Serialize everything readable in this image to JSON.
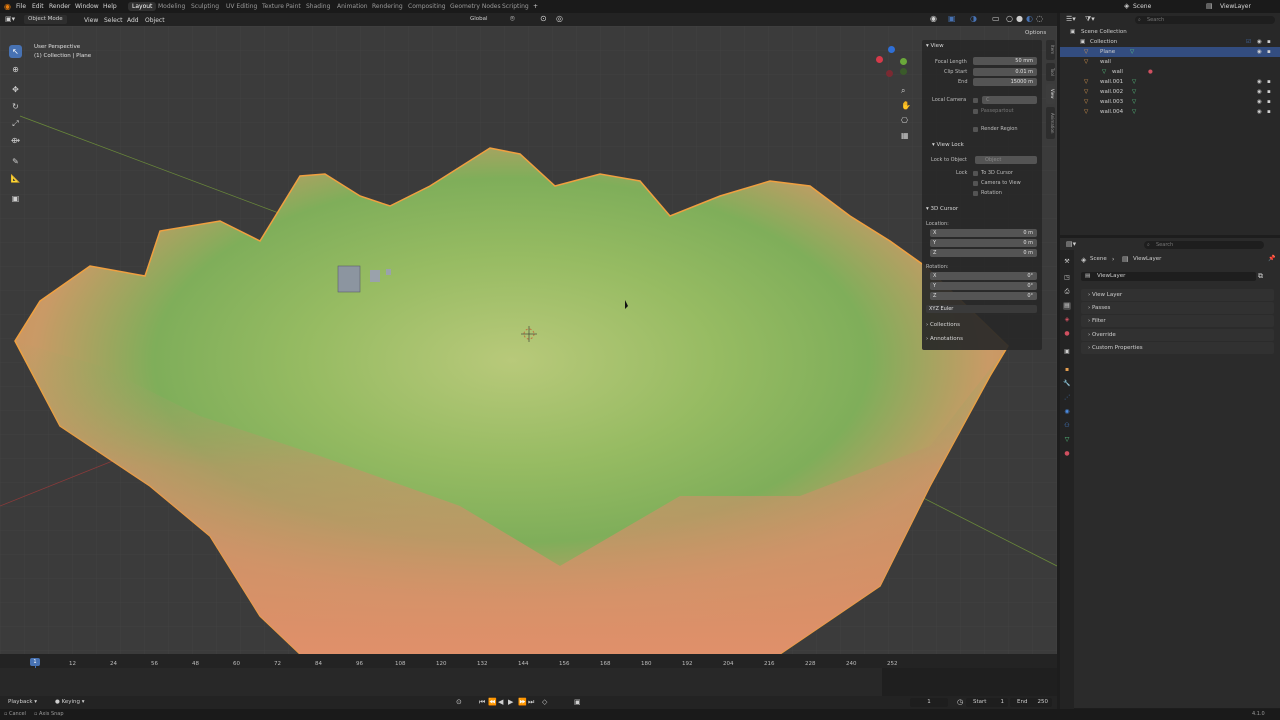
{
  "topbar": {
    "menus": [
      "File",
      "Edit",
      "Render",
      "Window",
      "Help"
    ],
    "workspaces": [
      "Layout",
      "Modeling",
      "Sculpting",
      "UV Editing",
      "Texture Paint",
      "Shading",
      "Animation",
      "Rendering",
      "Compositing",
      "Geometry Nodes",
      "Scripting"
    ],
    "add_tab": "+",
    "scene": "Scene",
    "viewlayer": "ViewLayer"
  },
  "viewport_header": {
    "mode": "Object Mode",
    "menus": [
      "View",
      "Select",
      "Add",
      "Object"
    ],
    "orientation": "Global",
    "options": "Options"
  },
  "viewport": {
    "perspective": "User Perspective",
    "context": "(1) Collection | Plane"
  },
  "npanel": {
    "view_title": "View",
    "focal_length_label": "Focal Length",
    "focal_length_value": "50 mm",
    "clip_start_label": "Clip Start",
    "clip_start_value": "0.01 m",
    "end_label": "End",
    "end_value": "15000 m",
    "local_camera_label": "Local Camera",
    "local_camera_placeholder": "C",
    "passepartout": "Passepartout",
    "render_region": "Render Region",
    "view_lock_title": "View Lock",
    "lock_to_object_label": "Lock to Object",
    "lock_to_object_placeholder": "Object",
    "lock_label": "Lock",
    "to_3d_cursor": "To 3D Cursor",
    "camera_to_view": "Camera to View",
    "rotation_opt": "Rotation",
    "cursor_title": "3D Cursor",
    "location_label": "Location:",
    "rotation_label": "Rotation:",
    "loc": [
      {
        "axis": "X",
        "value": "0 m"
      },
      {
        "axis": "Y",
        "value": "0 m"
      },
      {
        "axis": "Z",
        "value": "0 m"
      }
    ],
    "rot": [
      {
        "axis": "X",
        "value": "0°"
      },
      {
        "axis": "Y",
        "value": "0°"
      },
      {
        "axis": "Z",
        "value": "0°"
      }
    ],
    "rotation_mode": "XYZ Euler",
    "collections": "Collections",
    "annotations": "Annotations",
    "tabs": [
      "Item",
      "Tool",
      "View",
      "Animation"
    ]
  },
  "outliner": {
    "search_placeholder": "Search",
    "rows": [
      {
        "label": "Scene Collection"
      },
      {
        "label": "Collection"
      },
      {
        "label": "Plane"
      },
      {
        "label": "wall"
      },
      {
        "label": "wall"
      },
      {
        "label": "wall.001"
      },
      {
        "label": "wall.002"
      },
      {
        "label": "wall.003"
      },
      {
        "label": "wall.004"
      }
    ]
  },
  "properties": {
    "search_placeholder": "Search",
    "breadcrumb_scene": "Scene",
    "breadcrumb_viewlayer": "ViewLayer",
    "viewlayer_name": "ViewLayer",
    "sections": [
      "View Layer",
      "Passes",
      "Filter",
      "Override",
      "Custom Properties"
    ]
  },
  "timeline": {
    "ticks": [
      "1",
      "12",
      "24",
      "56",
      "48",
      "60",
      "72",
      "84",
      "96",
      "108",
      "120",
      "132",
      "144",
      "156",
      "168",
      "180",
      "192",
      "204",
      "216",
      "228",
      "240",
      "252"
    ],
    "current_frame": "1"
  },
  "playback": {
    "playback_label": "Playback",
    "keying_label": "Keying",
    "frame": "1",
    "start_label": "Start",
    "start_value": "1",
    "end_label": "End",
    "end_value": "250"
  },
  "statusbar": {
    "left1": "Cancel",
    "left2": "Axis Snap",
    "version": "4.1.0"
  },
  "colors": {
    "accent": "#4772b3",
    "selected_row": "#334d80",
    "terrain_green": "#8fb45a",
    "terrain_orange": "#d9895a",
    "outline": "#f0a040"
  }
}
